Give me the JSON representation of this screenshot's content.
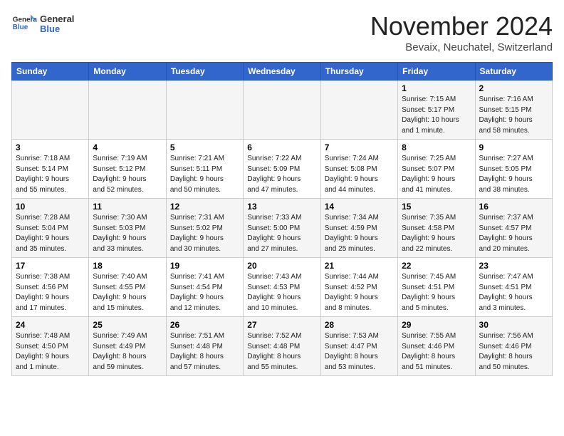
{
  "header": {
    "logo_line1": "General",
    "logo_line2": "Blue",
    "month_title": "November 2024",
    "location": "Bevaix, Neuchatel, Switzerland"
  },
  "days_of_week": [
    "Sunday",
    "Monday",
    "Tuesday",
    "Wednesday",
    "Thursday",
    "Friday",
    "Saturday"
  ],
  "weeks": [
    [
      {
        "day": "",
        "info": ""
      },
      {
        "day": "",
        "info": ""
      },
      {
        "day": "",
        "info": ""
      },
      {
        "day": "",
        "info": ""
      },
      {
        "day": "",
        "info": ""
      },
      {
        "day": "1",
        "info": "Sunrise: 7:15 AM\nSunset: 5:17 PM\nDaylight: 10 hours\nand 1 minute."
      },
      {
        "day": "2",
        "info": "Sunrise: 7:16 AM\nSunset: 5:15 PM\nDaylight: 9 hours\nand 58 minutes."
      }
    ],
    [
      {
        "day": "3",
        "info": "Sunrise: 7:18 AM\nSunset: 5:14 PM\nDaylight: 9 hours\nand 55 minutes."
      },
      {
        "day": "4",
        "info": "Sunrise: 7:19 AM\nSunset: 5:12 PM\nDaylight: 9 hours\nand 52 minutes."
      },
      {
        "day": "5",
        "info": "Sunrise: 7:21 AM\nSunset: 5:11 PM\nDaylight: 9 hours\nand 50 minutes."
      },
      {
        "day": "6",
        "info": "Sunrise: 7:22 AM\nSunset: 5:09 PM\nDaylight: 9 hours\nand 47 minutes."
      },
      {
        "day": "7",
        "info": "Sunrise: 7:24 AM\nSunset: 5:08 PM\nDaylight: 9 hours\nand 44 minutes."
      },
      {
        "day": "8",
        "info": "Sunrise: 7:25 AM\nSunset: 5:07 PM\nDaylight: 9 hours\nand 41 minutes."
      },
      {
        "day": "9",
        "info": "Sunrise: 7:27 AM\nSunset: 5:05 PM\nDaylight: 9 hours\nand 38 minutes."
      }
    ],
    [
      {
        "day": "10",
        "info": "Sunrise: 7:28 AM\nSunset: 5:04 PM\nDaylight: 9 hours\nand 35 minutes."
      },
      {
        "day": "11",
        "info": "Sunrise: 7:30 AM\nSunset: 5:03 PM\nDaylight: 9 hours\nand 33 minutes."
      },
      {
        "day": "12",
        "info": "Sunrise: 7:31 AM\nSunset: 5:02 PM\nDaylight: 9 hours\nand 30 minutes."
      },
      {
        "day": "13",
        "info": "Sunrise: 7:33 AM\nSunset: 5:00 PM\nDaylight: 9 hours\nand 27 minutes."
      },
      {
        "day": "14",
        "info": "Sunrise: 7:34 AM\nSunset: 4:59 PM\nDaylight: 9 hours\nand 25 minutes."
      },
      {
        "day": "15",
        "info": "Sunrise: 7:35 AM\nSunset: 4:58 PM\nDaylight: 9 hours\nand 22 minutes."
      },
      {
        "day": "16",
        "info": "Sunrise: 7:37 AM\nSunset: 4:57 PM\nDaylight: 9 hours\nand 20 minutes."
      }
    ],
    [
      {
        "day": "17",
        "info": "Sunrise: 7:38 AM\nSunset: 4:56 PM\nDaylight: 9 hours\nand 17 minutes."
      },
      {
        "day": "18",
        "info": "Sunrise: 7:40 AM\nSunset: 4:55 PM\nDaylight: 9 hours\nand 15 minutes."
      },
      {
        "day": "19",
        "info": "Sunrise: 7:41 AM\nSunset: 4:54 PM\nDaylight: 9 hours\nand 12 minutes."
      },
      {
        "day": "20",
        "info": "Sunrise: 7:43 AM\nSunset: 4:53 PM\nDaylight: 9 hours\nand 10 minutes."
      },
      {
        "day": "21",
        "info": "Sunrise: 7:44 AM\nSunset: 4:52 PM\nDaylight: 9 hours\nand 8 minutes."
      },
      {
        "day": "22",
        "info": "Sunrise: 7:45 AM\nSunset: 4:51 PM\nDaylight: 9 hours\nand 5 minutes."
      },
      {
        "day": "23",
        "info": "Sunrise: 7:47 AM\nSunset: 4:51 PM\nDaylight: 9 hours\nand 3 minutes."
      }
    ],
    [
      {
        "day": "24",
        "info": "Sunrise: 7:48 AM\nSunset: 4:50 PM\nDaylight: 9 hours\nand 1 minute."
      },
      {
        "day": "25",
        "info": "Sunrise: 7:49 AM\nSunset: 4:49 PM\nDaylight: 8 hours\nand 59 minutes."
      },
      {
        "day": "26",
        "info": "Sunrise: 7:51 AM\nSunset: 4:48 PM\nDaylight: 8 hours\nand 57 minutes."
      },
      {
        "day": "27",
        "info": "Sunrise: 7:52 AM\nSunset: 4:48 PM\nDaylight: 8 hours\nand 55 minutes."
      },
      {
        "day": "28",
        "info": "Sunrise: 7:53 AM\nSunset: 4:47 PM\nDaylight: 8 hours\nand 53 minutes."
      },
      {
        "day": "29",
        "info": "Sunrise: 7:55 AM\nSunset: 4:46 PM\nDaylight: 8 hours\nand 51 minutes."
      },
      {
        "day": "30",
        "info": "Sunrise: 7:56 AM\nSunset: 4:46 PM\nDaylight: 8 hours\nand 50 minutes."
      }
    ]
  ]
}
